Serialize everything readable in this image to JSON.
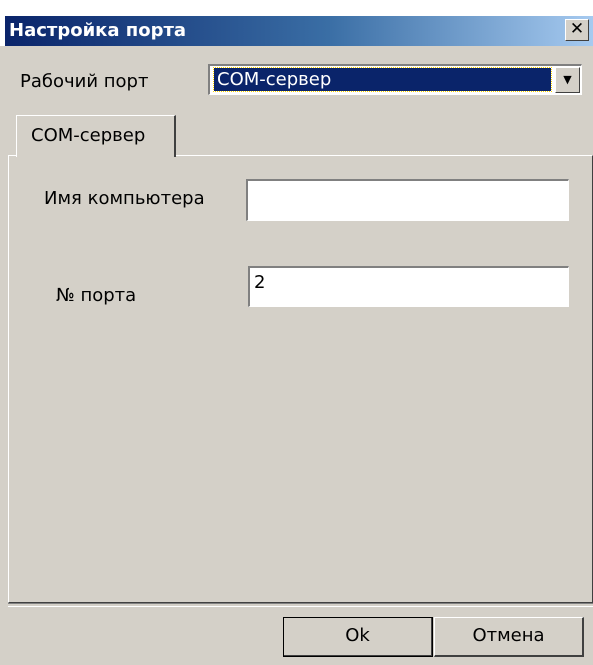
{
  "window": {
    "title": "Настройка порта",
    "close_symbol": "✕"
  },
  "port_select": {
    "label": "Рабочий порт",
    "selected": "COM-сервер",
    "arrow": "▼"
  },
  "tabs": [
    {
      "label": "COM-сервер",
      "active": true
    }
  ],
  "form": {
    "computer_name_label": "Имя компьютера",
    "computer_name_value": "",
    "port_number_label": "№ порта",
    "port_number_value": "2"
  },
  "buttons": {
    "ok_label": "Ok",
    "cancel_label": "Отмена"
  },
  "colors": {
    "face": "#d4d0c8",
    "titlebar_start": "#0a246a",
    "titlebar_end": "#a6caf0",
    "selection": "#0a246a"
  }
}
